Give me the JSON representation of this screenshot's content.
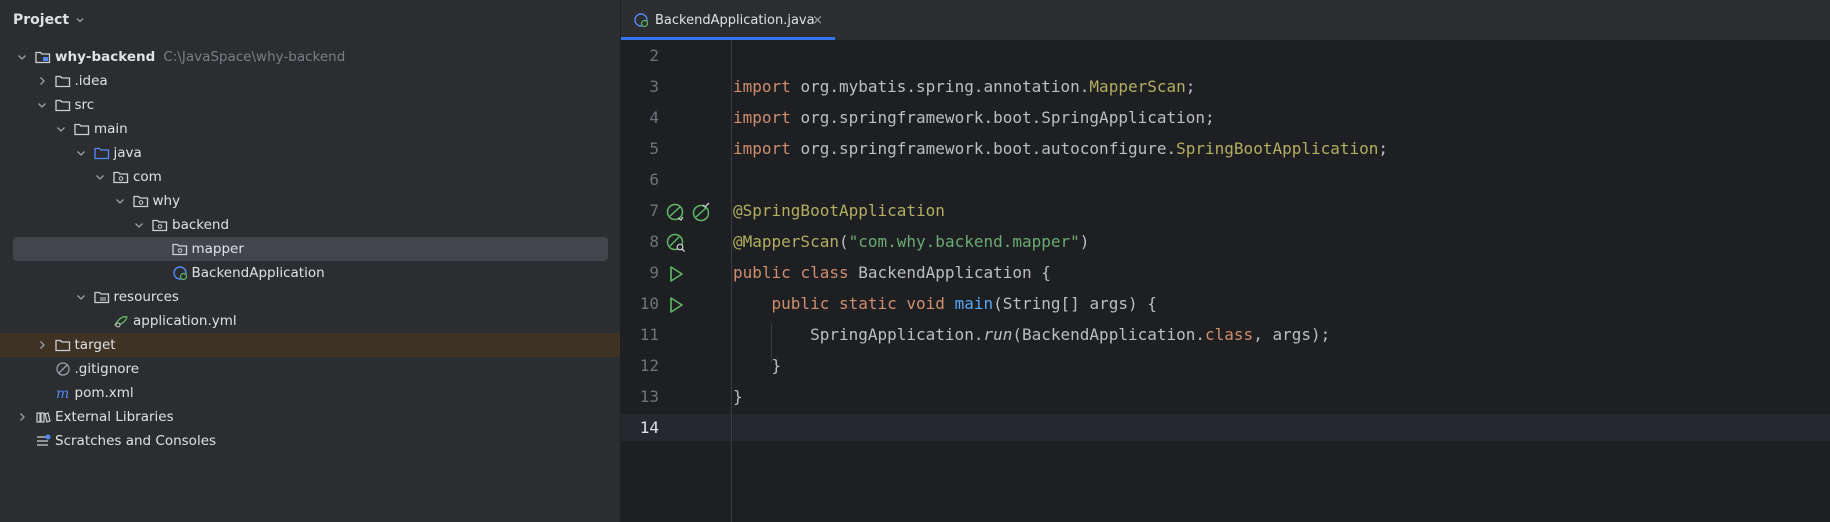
{
  "project": {
    "title": "Project",
    "tree": [
      {
        "label": "why-backend",
        "hint": "C:\\JavaSpace\\why-backend",
        "depth": 0,
        "expanded": true,
        "icon": "module-folder-icon",
        "bold": true
      },
      {
        "label": ".idea",
        "depth": 1,
        "expanded": false,
        "icon": "folder-icon"
      },
      {
        "label": "src",
        "depth": 1,
        "expanded": true,
        "icon": "folder-icon"
      },
      {
        "label": "main",
        "depth": 2,
        "expanded": true,
        "icon": "folder-icon"
      },
      {
        "label": "java",
        "depth": 3,
        "expanded": true,
        "icon": "source-folder-icon"
      },
      {
        "label": "com",
        "depth": 4,
        "expanded": true,
        "icon": "package-icon"
      },
      {
        "label": "why",
        "depth": 5,
        "expanded": true,
        "icon": "package-icon"
      },
      {
        "label": "backend",
        "depth": 6,
        "expanded": true,
        "icon": "package-icon"
      },
      {
        "label": "mapper",
        "depth": 7,
        "icon": "package-icon",
        "selected": true
      },
      {
        "label": "BackendApplication",
        "depth": 7,
        "icon": "spring-class-icon"
      },
      {
        "label": "resources",
        "depth": 3,
        "expanded": true,
        "icon": "resources-folder-icon"
      },
      {
        "label": "application.yml",
        "depth": 4,
        "icon": "yaml-spring-icon"
      },
      {
        "label": "target",
        "depth": 1,
        "expanded": false,
        "icon": "folder-icon",
        "excluded": true
      },
      {
        "label": ".gitignore",
        "depth": 1,
        "icon": "gitignore-icon"
      },
      {
        "label": "pom.xml",
        "depth": 1,
        "icon": "maven-icon"
      },
      {
        "label": "External Libraries",
        "depth": 0,
        "expanded": false,
        "icon": "library-icon"
      },
      {
        "label": "Scratches and Consoles",
        "depth": 0,
        "icon": "scratches-icon"
      }
    ]
  },
  "editor": {
    "tab": {
      "label": "BackendApplication.java",
      "close": "×"
    },
    "current_line": "14",
    "lines": [
      {
        "n": "2",
        "tokens": []
      },
      {
        "n": "3",
        "tokens": [
          {
            "t": "import ",
            "c": "kw"
          },
          {
            "t": "org.mybatis.spring.annotation.",
            "c": ""
          },
          {
            "t": "MapperScan",
            "c": "ann"
          },
          {
            "t": ";",
            "c": ""
          }
        ]
      },
      {
        "n": "4",
        "tokens": [
          {
            "t": "import ",
            "c": "kw"
          },
          {
            "t": "org.springframework.boot.SpringApplication;",
            "c": ""
          }
        ]
      },
      {
        "n": "5",
        "tokens": [
          {
            "t": "import ",
            "c": "kw"
          },
          {
            "t": "org.springframework.boot.autoconfigure.",
            "c": ""
          },
          {
            "t": "SpringBootApplication",
            "c": "ann"
          },
          {
            "t": ";",
            "c": ""
          }
        ]
      },
      {
        "n": "6",
        "tokens": []
      },
      {
        "n": "7",
        "tokens": [
          {
            "t": "@SpringBootApplication",
            "c": "ann"
          }
        ],
        "gutter": [
          "spring-bean-icon",
          "spring-boot-run-icon"
        ]
      },
      {
        "n": "8",
        "tokens": [
          {
            "t": "@MapperScan",
            "c": "ann"
          },
          {
            "t": "(",
            "c": ""
          },
          {
            "t": "\"com.why.backend.mapper\"",
            "c": "str"
          },
          {
            "t": ")",
            "c": ""
          }
        ],
        "gutter": [
          "spring-search-icon"
        ]
      },
      {
        "n": "9",
        "tokens": [
          {
            "t": "public ",
            "c": "kw"
          },
          {
            "t": "class ",
            "c": "kw"
          },
          {
            "t": "BackendApplication {",
            "c": ""
          }
        ],
        "gutter": [
          "run-icon"
        ]
      },
      {
        "n": "10",
        "tokens": [
          {
            "t": "    ",
            "c": ""
          },
          {
            "t": "public ",
            "c": "kw"
          },
          {
            "t": "static ",
            "c": "kw"
          },
          {
            "t": "void ",
            "c": "kw"
          },
          {
            "t": "main",
            "c": "fn"
          },
          {
            "t": "(String[] args) {",
            "c": ""
          }
        ],
        "gutter": [
          "run-icon"
        ]
      },
      {
        "n": "11",
        "tokens": [
          {
            "t": "        SpringApplication.",
            "c": ""
          },
          {
            "t": "run",
            "c": "it"
          },
          {
            "t": "(BackendApplication.",
            "c": ""
          },
          {
            "t": "class",
            "c": "kw"
          },
          {
            "t": ", args);",
            "c": ""
          }
        ]
      },
      {
        "n": "12",
        "tokens": [
          {
            "t": "    }",
            "c": ""
          }
        ]
      },
      {
        "n": "13",
        "tokens": [
          {
            "t": "}",
            "c": ""
          }
        ]
      },
      {
        "n": "14",
        "tokens": []
      }
    ]
  },
  "colors": {
    "accent": "#3574f0",
    "keyword": "#cf8e6d",
    "annotation": "#b3ae60",
    "string": "#6aab73",
    "function": "#56a8f5",
    "run": "#5fb865"
  }
}
